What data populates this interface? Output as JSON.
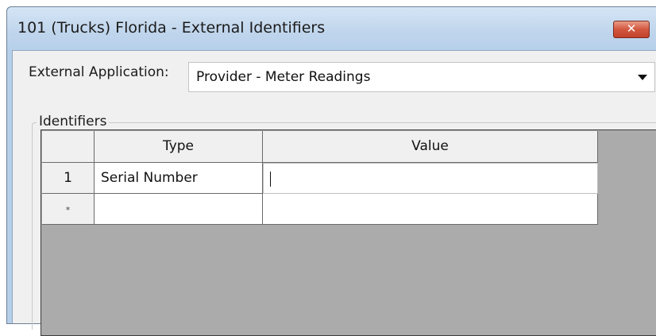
{
  "window": {
    "title": "101 (Trucks) Florida - External Identifiers",
    "close_glyph": "✕"
  },
  "external_application": {
    "label": "External Application:",
    "selected_value": "Provider  - Meter Readings"
  },
  "identifiers": {
    "group_label": "Identifiers",
    "columns": [
      "Type",
      "Value"
    ],
    "rows": [
      {
        "row_header": "1",
        "type": "Serial Number",
        "value": ""
      }
    ],
    "new_row_marker": "*"
  }
}
